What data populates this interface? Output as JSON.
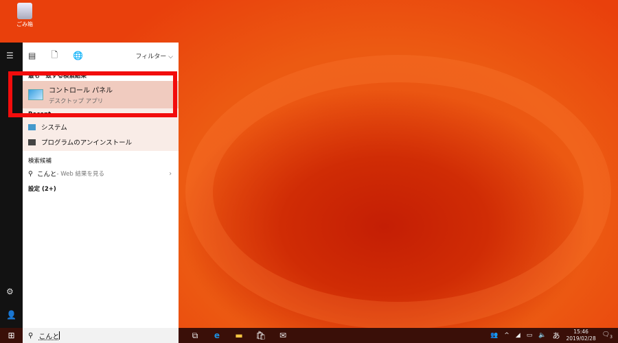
{
  "desktop": {
    "recycle_bin": "ごみ箱"
  },
  "panel": {
    "filter": "フィルター",
    "best_match_header": "最も一致する検索結果",
    "best_match": {
      "title": "コントロール パネル",
      "subtitle": "デスクトップ アプリ"
    },
    "recent_header": "Recent",
    "recent": [
      {
        "label": "システム"
      },
      {
        "label": "プログラムのアンインストール"
      }
    ],
    "suggest_header": "検索候補",
    "web_query": "こんと",
    "web_suffix": " - Web 結果を見る",
    "settings": "設定 (2+)"
  },
  "search": {
    "value": "こんと"
  },
  "clock": {
    "time": "15:46",
    "date": "2019/02/28"
  },
  "tray": {
    "ime": "あ",
    "notifications": "3"
  },
  "colors": {
    "highlight": "#f20c0c",
    "best_bg": "#f0cbbf"
  }
}
